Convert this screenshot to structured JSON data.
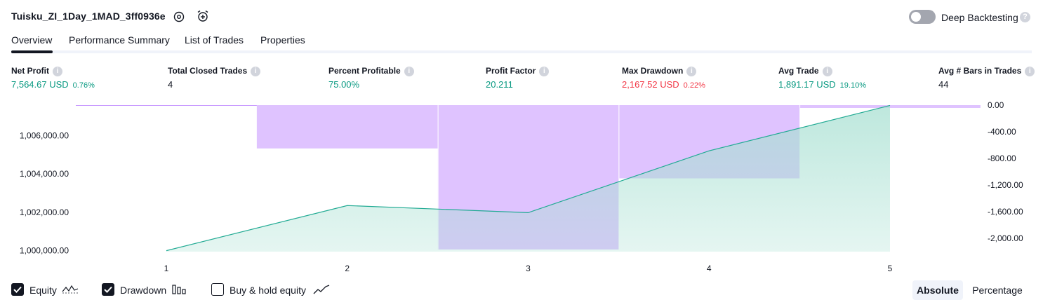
{
  "header": {
    "strategy_name": "Tuisku_ZI_1Day_1MAD_3ff0936e",
    "deep_backtesting_label": "Deep Backtesting",
    "deep_backtesting_enabled": false,
    "help_icon": "question-circle-icon",
    "settings_icon": "gear-icon",
    "add_alert_icon": "alarm-clock-plus-icon"
  },
  "tabs": [
    {
      "label": "Overview",
      "active": true
    },
    {
      "label": "Performance Summary",
      "active": false
    },
    {
      "label": "List of Trades",
      "active": false
    },
    {
      "label": "Properties",
      "active": false
    }
  ],
  "stats": [
    {
      "label": "Net Profit",
      "value": "7,564.67 USD",
      "pct": "0.76%",
      "color": "#089981"
    },
    {
      "label": "Total Closed Trades",
      "value": "4",
      "pct": "",
      "color": "#131722"
    },
    {
      "label": "Percent Profitable",
      "value": "75.00%",
      "pct": "",
      "color": "#089981"
    },
    {
      "label": "Profit Factor",
      "value": "20.211",
      "pct": "",
      "color": "#089981"
    },
    {
      "label": "Max Drawdown",
      "value": "2,167.52 USD",
      "pct": "0.22%",
      "color": "#f23645"
    },
    {
      "label": "Avg Trade",
      "value": "1,891.17 USD",
      "pct": "19.10%",
      "color": "#089981"
    },
    {
      "label": "Avg # Bars in Trades",
      "value": "44",
      "pct": "",
      "color": "#131722"
    }
  ],
  "chart_data": {
    "type": "area",
    "x": [
      1,
      2,
      3,
      4,
      5
    ],
    "x_tick_labels": [
      "1",
      "2",
      "3",
      "4",
      "5"
    ],
    "left_axis": {
      "ticks": [
        1000000,
        1002000,
        1004000,
        1006000
      ],
      "tick_labels": [
        "1,000,000.00",
        "1,002,000.00",
        "1,004,000.00",
        "1,006,000.00"
      ],
      "range": [
        999950,
        1007580
      ]
    },
    "right_axis": {
      "ticks": [
        0,
        -400,
        -800,
        -1200,
        -1600,
        -2000
      ],
      "tick_labels": [
        "0.00",
        "-400.00",
        "-800.00",
        "-1,200.00",
        "-1,600.00",
        "-2,000.00"
      ],
      "range": [
        -2200,
        0
      ]
    },
    "series": [
      {
        "kind": "equity",
        "values": [
          1000000,
          1002350,
          1001980,
          1005200,
          1007565
        ],
        "line_color": "#22ab94",
        "fill_color": "#a8e0d2"
      },
      {
        "kind": "drawdown",
        "values": [
          0,
          -650,
          -2167.52,
          -1100,
          -40
        ],
        "color": "#c99bff"
      }
    ],
    "drawdown_bar_ranges": [
      [
        1.5,
        2.5
      ],
      [
        2.5,
        3.5
      ],
      [
        3.5,
        4.5
      ],
      [
        4.5,
        5.5
      ]
    ],
    "grid": false
  },
  "legend": {
    "equity": {
      "label": "Equity",
      "checked": true,
      "icon": "equity-line-icon"
    },
    "drawdown": {
      "label": "Drawdown",
      "checked": true,
      "icon": "drawdown-bars-icon"
    },
    "buy_hold": {
      "label": "Buy & hold equity",
      "checked": false,
      "icon": "buy-hold-line-icon"
    }
  },
  "view_mode": {
    "options": [
      "Absolute",
      "Percentage"
    ],
    "selected": "Absolute"
  }
}
